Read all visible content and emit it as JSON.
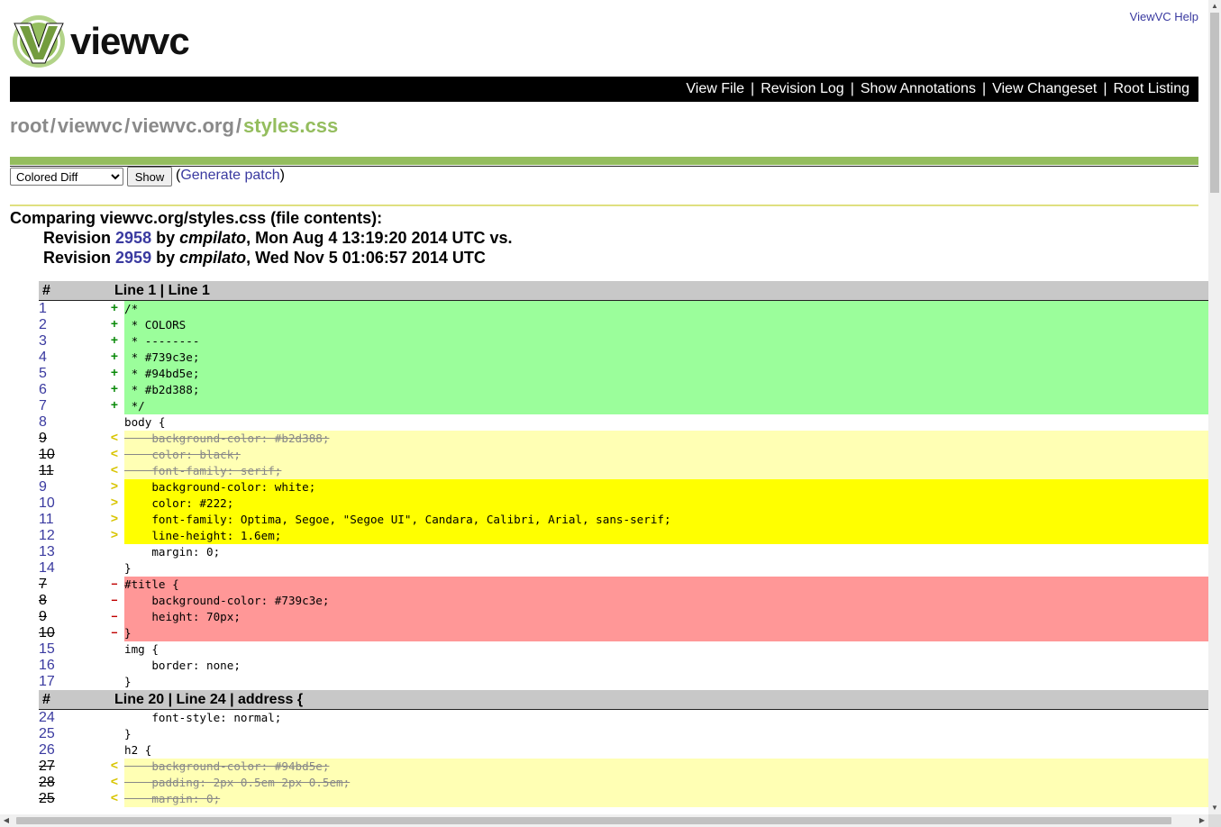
{
  "header": {
    "help": "ViewVC Help",
    "logo_text": "viewvc"
  },
  "nav": [
    "View File",
    "Revision Log",
    "Show Annotations",
    "View Changeset",
    "Root Listing"
  ],
  "breadcrumb": [
    "root",
    "viewvc",
    "viewvc.org",
    "styles.css"
  ],
  "controls": {
    "diff_format": "Colored Diff",
    "show": "Show",
    "patch_open": "(",
    "patch": "Generate patch",
    "patch_close": ")"
  },
  "compare": {
    "title": "Comparing viewvc.org/styles.css (file contents):",
    "rev1": {
      "prefix": "Revision ",
      "num": "2958",
      "by": " by ",
      "author": "cmpilato",
      "date": ", Mon Aug 4 13:19:20 2014 UTC vs."
    },
    "rev2": {
      "prefix": "Revision ",
      "num": "2959",
      "by": " by ",
      "author": "cmpilato",
      "date": ", Wed Nov 5 01:06:57 2014 UTC"
    }
  },
  "diff": {
    "hunks": [
      {
        "num_label": "#",
        "title": "Line 1 | Line 1",
        "rows": [
          {
            "n": "1",
            "type": "add",
            "mark": "+",
            "code": "/*"
          },
          {
            "n": "2",
            "type": "add",
            "mark": "+",
            "code": " * COLORS"
          },
          {
            "n": "3",
            "type": "add",
            "mark": "+",
            "code": " * --------"
          },
          {
            "n": "4",
            "type": "add",
            "mark": "+",
            "code": " * #739c3e;"
          },
          {
            "n": "5",
            "type": "add",
            "mark": "+",
            "code": " * #94bd5e;"
          },
          {
            "n": "6",
            "type": "add",
            "mark": "+",
            "code": " * #b2d388;"
          },
          {
            "n": "7",
            "type": "add",
            "mark": "+",
            "code": " */"
          },
          {
            "n": "8",
            "type": "ctx",
            "mark": "",
            "code": "body {"
          },
          {
            "n": "9",
            "type": "chg-old",
            "mark": "<",
            "code": "    background-color: #b2d388;"
          },
          {
            "n": "10",
            "type": "chg-old",
            "mark": "<",
            "code": "    color: black;"
          },
          {
            "n": "11",
            "type": "chg-old",
            "mark": "<",
            "code": "    font-family: serif;"
          },
          {
            "n": "9",
            "type": "chg-new",
            "mark": ">",
            "code": "    background-color: white;"
          },
          {
            "n": "10",
            "type": "chg-new",
            "mark": ">",
            "code": "    color: #222;"
          },
          {
            "n": "11",
            "type": "chg-new",
            "mark": ">",
            "code": "    font-family: Optima, Segoe, \"Segoe UI\", Candara, Calibri, Arial, sans-serif;"
          },
          {
            "n": "12",
            "type": "chg-new",
            "mark": ">",
            "code": "    line-height: 1.6em;"
          },
          {
            "n": "13",
            "type": "ctx",
            "mark": "",
            "code": "    margin: 0;"
          },
          {
            "n": "14",
            "type": "ctx",
            "mark": "",
            "code": "}"
          },
          {
            "n": "7",
            "type": "rem",
            "mark": "–",
            "code": "#title {"
          },
          {
            "n": "8",
            "type": "rem",
            "mark": "–",
            "code": "    background-color: #739c3e;"
          },
          {
            "n": "9",
            "type": "rem",
            "mark": "–",
            "code": "    height: 70px;"
          },
          {
            "n": "10",
            "type": "rem",
            "mark": "–",
            "code": "}"
          },
          {
            "n": "15",
            "type": "ctx",
            "mark": "",
            "code": "img {"
          },
          {
            "n": "16",
            "type": "ctx",
            "mark": "",
            "code": "    border: none;"
          },
          {
            "n": "17",
            "type": "ctx",
            "mark": "",
            "code": "}"
          }
        ]
      },
      {
        "num_label": "#",
        "title": "Line 20 | Line 24 | address {",
        "rows": [
          {
            "n": "24",
            "type": "ctx",
            "mark": "",
            "code": "    font-style: normal;"
          },
          {
            "n": "25",
            "type": "ctx",
            "mark": "",
            "code": "}"
          },
          {
            "n": "26",
            "type": "ctx",
            "mark": "",
            "code": "h2 {"
          },
          {
            "n": "27",
            "type": "chg-old",
            "mark": "<",
            "code": "    background-color: #94bd5e;"
          },
          {
            "n": "28",
            "type": "chg-old",
            "mark": "<",
            "code": "    padding: 2px 0.5em 2px 0.5em;"
          },
          {
            "n": "25",
            "type": "chg-old",
            "mark": "<",
            "code": "    margin: 0;"
          }
        ]
      }
    ]
  },
  "colors": {
    "accent": "#94bd5e",
    "added": "#9bfe9b",
    "changed_old": "#ffffb4",
    "changed_new": "#ffff00",
    "removed": "#ff9797",
    "link": "#3a3aa0"
  }
}
